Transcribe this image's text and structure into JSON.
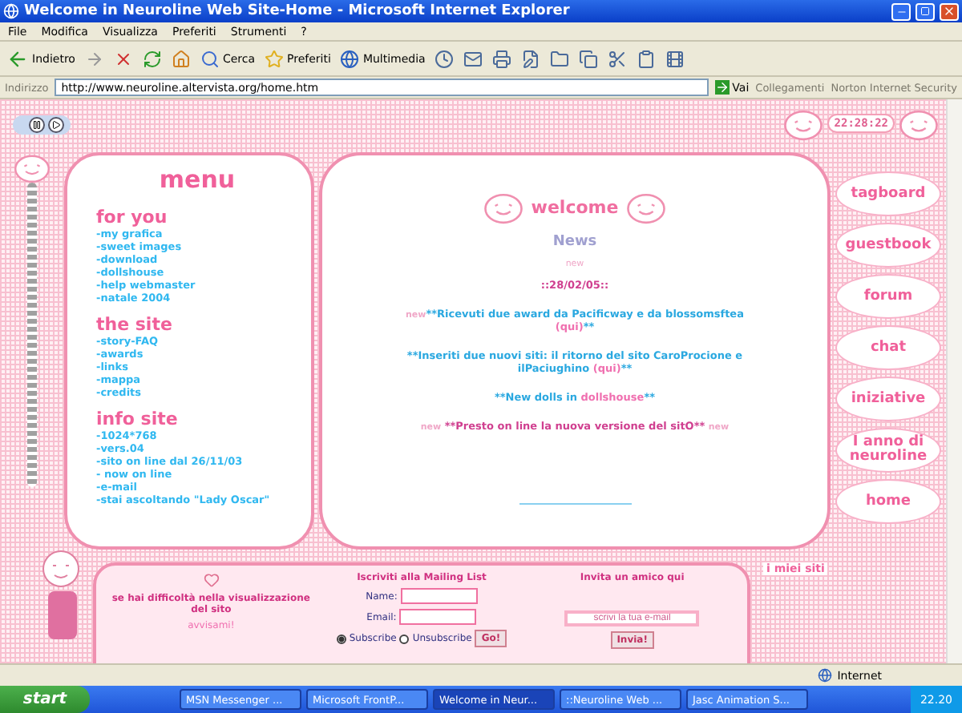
{
  "window": {
    "title": "Welcome in Neuroline Web Site-Home - Microsoft Internet Explorer"
  },
  "menu_bar": [
    "File",
    "Modifica",
    "Visualizza",
    "Preferiti",
    "Strumenti",
    "?"
  ],
  "toolbar": [
    {
      "kind": "back",
      "label": "Indietro"
    },
    {
      "kind": "forward"
    },
    {
      "kind": "stop"
    },
    {
      "kind": "refresh"
    },
    {
      "kind": "home"
    },
    {
      "kind": "search",
      "label": "Cerca"
    },
    {
      "kind": "favorites",
      "label": "Preferiti"
    },
    {
      "kind": "media",
      "label": "Multimedia"
    },
    {
      "kind": "history"
    },
    {
      "kind": "mail"
    },
    {
      "kind": "print"
    },
    {
      "kind": "edit"
    },
    {
      "kind": "folder"
    },
    {
      "kind": "copy"
    },
    {
      "kind": "cut"
    },
    {
      "kind": "paste"
    },
    {
      "kind": "film"
    }
  ],
  "address_bar": {
    "label": "Indirizzo",
    "url": "http://www.neuroline.altervista.org/home.htm",
    "go": "Vai",
    "links": "Collegamenti",
    "norton": "Norton Internet Security"
  },
  "page": {
    "clock": "22:28:22",
    "menu": {
      "title": "menu",
      "sections": [
        {
          "heading": "for you",
          "items": [
            "-my grafica",
            "-sweet images",
            "-download",
            "-dollshouse",
            "-help webmaster",
            "-natale 2004"
          ]
        },
        {
          "heading": "the site",
          "items": [
            "-story-FAQ",
            "-awards",
            "-links",
            "-mappa",
            "-credits"
          ]
        },
        {
          "heading": "info site",
          "items": [
            "-1024*768",
            "-vers.04",
            "-sito on line dal 26/11/03",
            "- now on line",
            "-e-mail",
            "-stai ascoltando \"Lady Oscar\""
          ]
        }
      ]
    },
    "welcome": {
      "title": "welcome",
      "subtitle": "News",
      "badge": "new",
      "date": "::28/02/05::",
      "news": [
        {
          "parts": [
            {
              "kind": "badge",
              "text": "new"
            },
            {
              "kind": "plain",
              "text": "**Ricevuti due award da Pacificway e da blossomsftea "
            },
            {
              "kind": "link",
              "text": "(qui)"
            },
            {
              "kind": "plain",
              "text": "**"
            }
          ]
        },
        {
          "parts": [
            {
              "kind": "plain",
              "text": "**Inseriti due nuovi siti: il ritorno del sito CaroProcione e ilPaciughino "
            },
            {
              "kind": "link",
              "text": "(qui)"
            },
            {
              "kind": "plain",
              "text": "**"
            }
          ]
        },
        {
          "parts": [
            {
              "kind": "plain",
              "text": "**New dolls in "
            },
            {
              "kind": "link",
              "text": "dollshouse"
            },
            {
              "kind": "plain",
              "text": "**"
            }
          ]
        },
        {
          "parts": [
            {
              "kind": "badge",
              "text": "new"
            },
            {
              "kind": "strong",
              "text": " **Presto on line la nuova versione del sitO** "
            },
            {
              "kind": "badge",
              "text": "new"
            }
          ]
        }
      ]
    },
    "nav": [
      "tagboard",
      "guestbook",
      "forum",
      "chat",
      "iniziative",
      "I anno di neuroline",
      "home"
    ],
    "footer": {
      "notice": "se hai difficoltà nella visualizzazione del sito",
      "notice_link": "avvisami!",
      "mailing": {
        "title": "Iscriviti alla Mailing List",
        "name_label": "Name:",
        "email_label": "Email:",
        "options": [
          {
            "label": "Subscribe",
            "selected": true
          },
          {
            "label": "Unsubscribe",
            "selected": false
          }
        ],
        "go": "Go!"
      },
      "invite": {
        "title": "Invita un amico qui",
        "placeholder": "scrivi la tua e-mail",
        "send": "Invia!"
      },
      "sites": "i miei siti"
    }
  },
  "status_bar": {
    "zone": "Internet"
  },
  "taskbar": {
    "start": "start",
    "tasks": [
      {
        "label": "MSN Messenger ...",
        "selected": false
      },
      {
        "label": "Microsoft FrontP...",
        "selected": false
      },
      {
        "label": "Welcome in Neur...",
        "selected": true
      },
      {
        "label": "::Neuroline Web ...",
        "selected": false
      },
      {
        "label": "Jasc Animation S...",
        "selected": false
      }
    ],
    "clock": "22.20"
  }
}
